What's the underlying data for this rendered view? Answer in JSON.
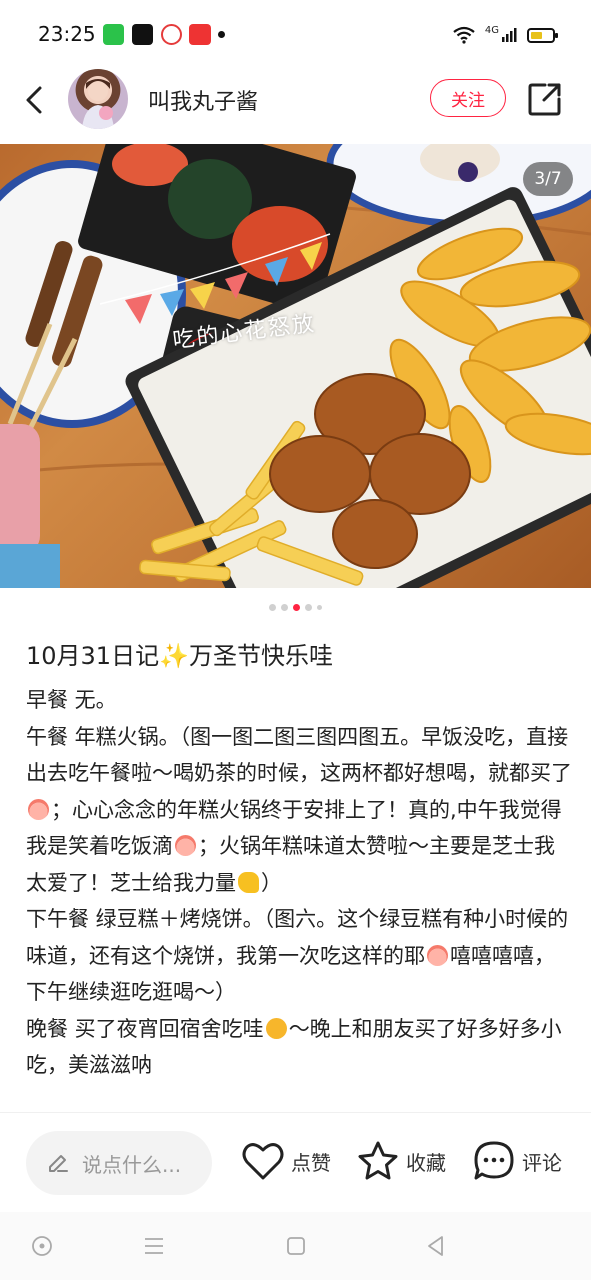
{
  "status_bar": {
    "time": "23:25",
    "network": "4G",
    "icons": [
      "iqiyi-app-icon",
      "soul-app-icon",
      "video-app-icon",
      "toutiao-app-icon",
      "wifi-icon",
      "signal-icon",
      "battery-icon"
    ]
  },
  "header": {
    "username": "叫我丸子酱",
    "follow_label": "关注"
  },
  "photo": {
    "page_counter": "3/7",
    "overlay_caption": "吃的心花怒放",
    "total_pages": 7,
    "current_page": 3
  },
  "post": {
    "title": "10月31日记✨万圣节快乐哇",
    "paragraphs": [
      {
        "text": "早餐 无。"
      },
      {
        "text": "午餐 年糕火锅。（图一图二图三图四图五。早饭没吃，直接出去吃午餐啦～喝奶茶的时候，这两杯都好想喝，就都买了",
        "emoji": "em-peach",
        "tail": "；心心念念的年糕火锅终于安排上了！真的,中午我觉得我是笑着吃饭滴",
        "emoji2": "em-peach",
        "tail2": "；火锅年糕味道太赞啦～主要是芝士我太爱了！芝士给我力量",
        "emoji3": "em-muscle",
        "tail3": "）"
      },
      {
        "text": "下午餐 绿豆糕＋烤烧饼。（图六。这个绿豆糕有种小时候的味道，还有这个烧饼，我第一次吃这样的耶",
        "emoji": "em-peach",
        "tail": "嘻嘻嘻嘻，下午继续逛吃逛喝～）"
      },
      {
        "text": "晚餐 买了夜宵回宿舍吃哇",
        "emoji": "em-sun",
        "tail": "～晚上和朋友买了好多好多小吃，美滋滋呐"
      }
    ]
  },
  "bottom_bar": {
    "comment_placeholder": "说点什么...",
    "like_label": "点赞",
    "favorite_label": "收藏",
    "comment_label": "评论"
  },
  "colors": {
    "accent": "#ff2442",
    "text": "#222222",
    "muted": "#999999"
  }
}
